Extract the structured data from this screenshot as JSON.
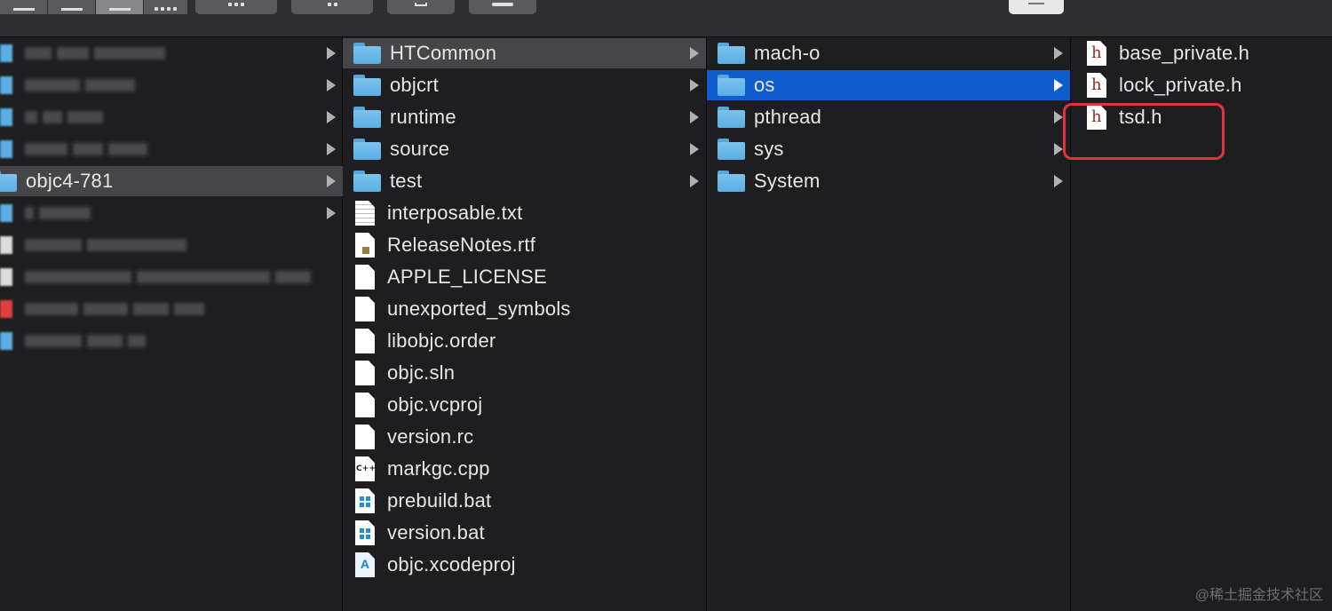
{
  "toolbar": {
    "view_modes": [
      "icon-view",
      "list-view",
      "column-view",
      "gallery-view"
    ],
    "active_view": "column-view",
    "buttons": [
      "group-icon",
      "action-gear-icon",
      "share-icon",
      "tag-icon",
      "search-field"
    ]
  },
  "column1": {
    "items": [
      {
        "label": "objc4-781",
        "kind": "folder",
        "selected": true,
        "row": 4
      }
    ]
  },
  "column2": {
    "items": [
      {
        "label": "HTCommon",
        "kind": "folder",
        "chevron": true,
        "selected": true
      },
      {
        "label": "objcrt",
        "kind": "folder",
        "chevron": true
      },
      {
        "label": "runtime",
        "kind": "folder",
        "chevron": true
      },
      {
        "label": "source",
        "kind": "folder",
        "chevron": true
      },
      {
        "label": "test",
        "kind": "folder",
        "chevron": true
      },
      {
        "label": "interposable.txt",
        "kind": "doc-lined"
      },
      {
        "label": "ReleaseNotes.rtf",
        "kind": "doc-rtf"
      },
      {
        "label": "APPLE_LICENSE",
        "kind": "doc"
      },
      {
        "label": "unexported_symbols",
        "kind": "doc"
      },
      {
        "label": "libobjc.order",
        "kind": "doc"
      },
      {
        "label": "objc.sln",
        "kind": "doc"
      },
      {
        "label": "objc.vcproj",
        "kind": "doc"
      },
      {
        "label": "version.rc",
        "kind": "doc"
      },
      {
        "label": "markgc.cpp",
        "kind": "doc-cpp"
      },
      {
        "label": "prebuild.bat",
        "kind": "doc-bat"
      },
      {
        "label": "version.bat",
        "kind": "doc-bat"
      },
      {
        "label": "objc.xcodeproj",
        "kind": "doc-xcode"
      }
    ]
  },
  "column3": {
    "items": [
      {
        "label": "mach-o",
        "kind": "folder",
        "chevron": true
      },
      {
        "label": "os",
        "kind": "folder",
        "chevron": true,
        "selected": true
      },
      {
        "label": "pthread",
        "kind": "folder",
        "chevron": true
      },
      {
        "label": "sys",
        "kind": "folder",
        "chevron": true
      },
      {
        "label": "System",
        "kind": "folder",
        "chevron": true
      }
    ]
  },
  "column4": {
    "items": [
      {
        "label": "base_private.h",
        "kind": "doc-h"
      },
      {
        "label": "lock_private.h",
        "kind": "doc-h"
      },
      {
        "label": "tsd.h",
        "kind": "doc-h",
        "highlighted": true
      }
    ]
  },
  "watermark": "@稀土掘金技术社区",
  "colors": {
    "background": "#1e1e20",
    "selection_blue": "#0f5ccf",
    "selection_gray": "#464649",
    "folder_blue": "#6bb8ea",
    "highlight_red": "#e0343d"
  }
}
